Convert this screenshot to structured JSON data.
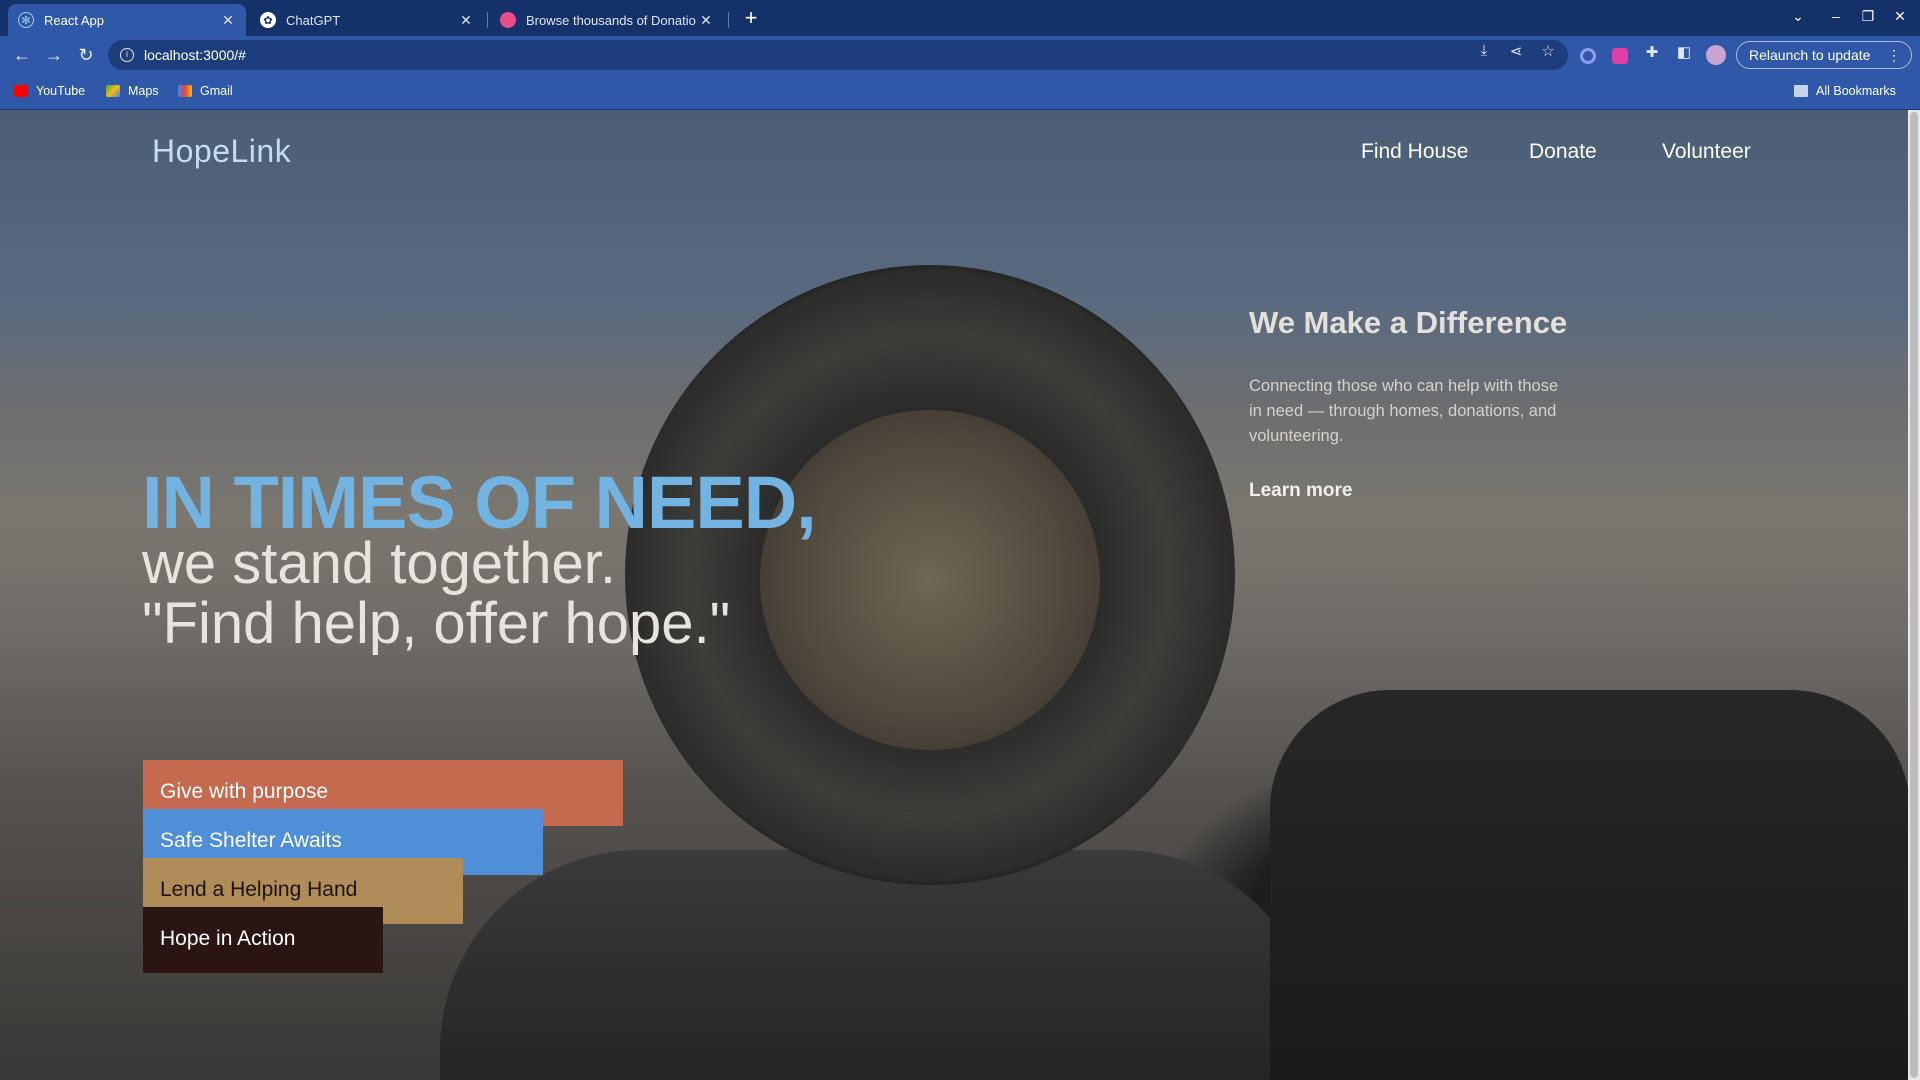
{
  "browser": {
    "tabs": [
      {
        "title": "React App",
        "icon": "react-icon",
        "active": true
      },
      {
        "title": "ChatGPT",
        "icon": "chatgpt-icon",
        "active": false
      },
      {
        "title": "Browse thousands of Donatio",
        "icon": "dribbble-icon",
        "active": false
      }
    ],
    "url": "localhost:3000/#",
    "relaunch_label": "Relaunch to update",
    "bookmarks": [
      {
        "label": "YouTube",
        "icon": "youtube-icon"
      },
      {
        "label": "Maps",
        "icon": "maps-icon"
      },
      {
        "label": "Gmail",
        "icon": "gmail-icon"
      }
    ],
    "all_bookmarks_label": "All Bookmarks"
  },
  "page": {
    "brand": "HopeLink",
    "nav": [
      "Find House",
      "Donate",
      "Volunteer"
    ],
    "hero": {
      "accent": "IN TIMES OF NEED,",
      "line1": "we stand together.",
      "line2": "\"Find help, offer hope.\""
    },
    "pills": [
      {
        "label": "Give with purpose",
        "color": "#c66a4f"
      },
      {
        "label": "Safe Shelter Awaits",
        "color": "#4e8fd8"
      },
      {
        "label": "Lend a Helping Hand",
        "color": "#b08d58"
      },
      {
        "label": "Hope in Action",
        "color": "#2a1512"
      }
    ],
    "side": {
      "title": "We Make a Difference",
      "text": "Connecting those who can help with those in need — through homes, donations, and volunteering.",
      "link": "Learn more"
    }
  },
  "colors": {
    "accent_blue": "#72b3e1",
    "chrome_blue": "#2f58a8"
  }
}
